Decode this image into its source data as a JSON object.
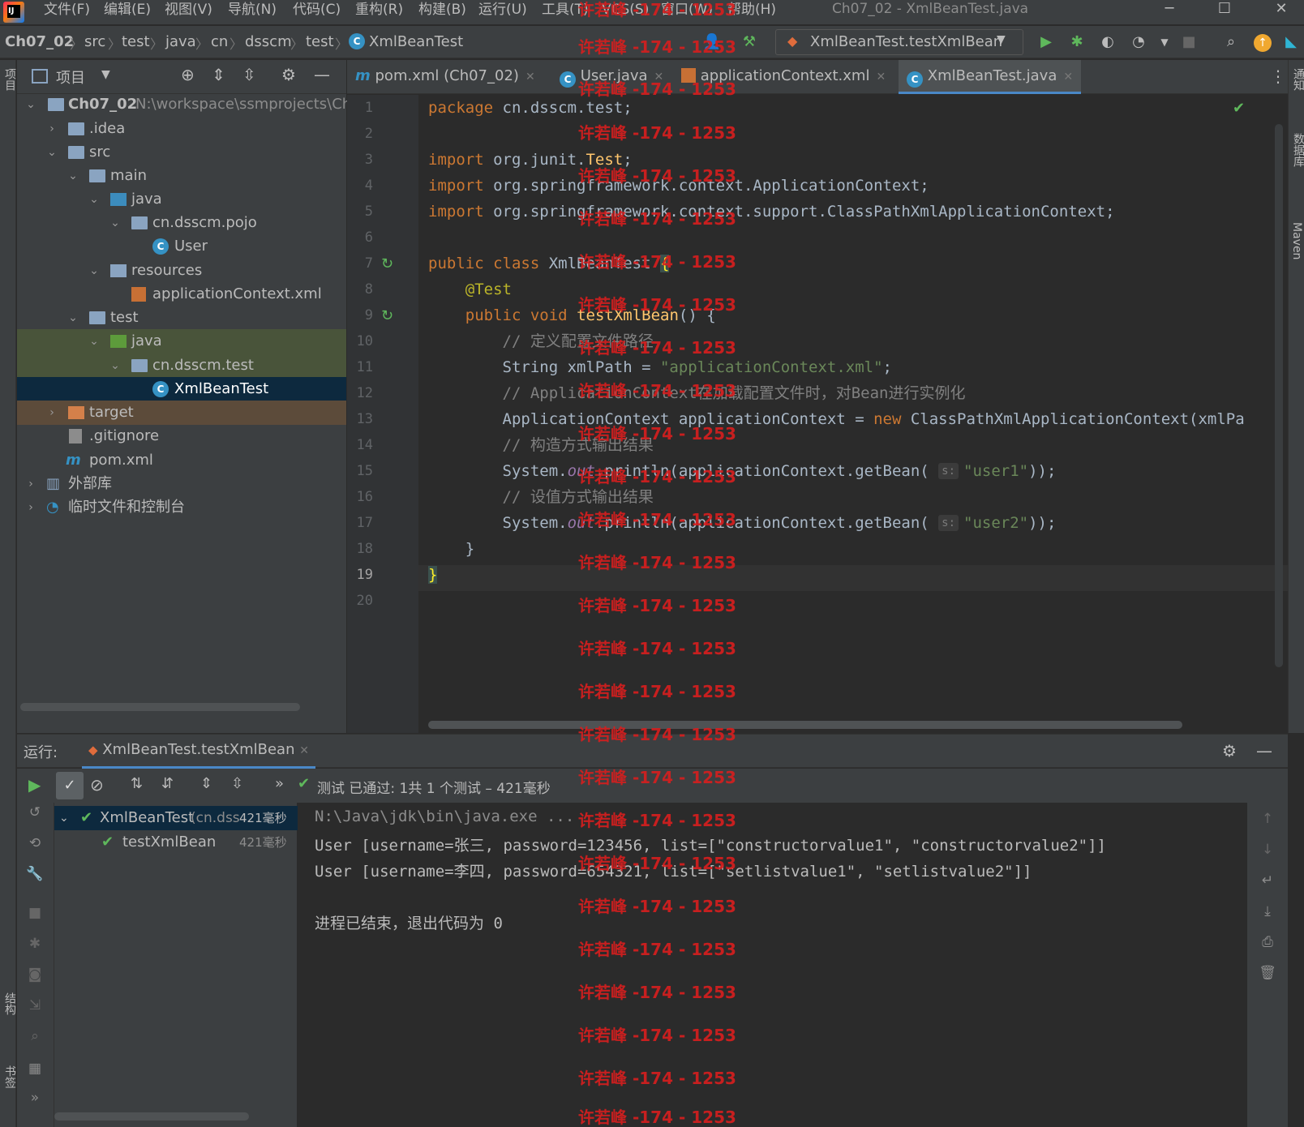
{
  "window": {
    "title": "Ch07_02 - XmlBeanTest.java"
  },
  "menu": [
    "文件(F)",
    "编辑(E)",
    "视图(V)",
    "导航(N)",
    "代码(C)",
    "重构(R)",
    "构建(B)",
    "运行(U)",
    "工具(T)",
    "VCS(S)",
    "窗口(W)",
    "帮助(H)"
  ],
  "breadcrumb": [
    "Ch07_02",
    "src",
    "test",
    "java",
    "cn",
    "dsscm",
    "test",
    "XmlBeanTest"
  ],
  "run_config": "XmlBeanTest.testXmlBean",
  "project": {
    "header": "项目",
    "tree": [
      {
        "label": "Ch07_02",
        "path": "N:\\workspace\\ssmprojects\\Ch"
      },
      {
        "label": ".idea"
      },
      {
        "label": "src"
      },
      {
        "label": "main"
      },
      {
        "label": "java"
      },
      {
        "label": "cn.dsscm.pojo"
      },
      {
        "label": "User"
      },
      {
        "label": "resources"
      },
      {
        "label": "applicationContext.xml"
      },
      {
        "label": "test"
      },
      {
        "label": "java"
      },
      {
        "label": "cn.dsscm.test"
      },
      {
        "label": "XmlBeanTest"
      },
      {
        "label": "target"
      },
      {
        "label": ".gitignore"
      },
      {
        "label": "pom.xml"
      },
      {
        "label": "外部库"
      },
      {
        "label": "临时文件和控制台"
      }
    ]
  },
  "tabs": [
    "pom.xml (Ch07_02)",
    "User.java",
    "applicationContext.xml",
    "XmlBeanTest.java"
  ],
  "code": {
    "pkg": "cn.dsscm.test",
    "imp1": "org.junit.",
    "imp1b": "Test",
    "imp2": "org.springframework.context.ApplicationContext",
    "imp3": "org.springframework.context.support.ClassPathXmlApplicationContext",
    "cls": "XmlBeanTest",
    "anno": "@Test",
    "method": "testXmlBean",
    "c1": "// 定义配置文件路径",
    "xmlpath": "\"applicationContext.xml\"",
    "c2": "// ApplicationContext在加载配置文件时，对Bean进行实例化",
    "line13b": "ClassPathXmlApplicationContext(xmlPa",
    "c3": "// 构造方式输出结果",
    "user1": "\"user1\"",
    "c4": "// 设值方式输出结果",
    "user2": "\"user2\"",
    "hint": "s:"
  },
  "line_numbers": [
    "1",
    "2",
    "3",
    "4",
    "5",
    "6",
    "7",
    "8",
    "9",
    "10",
    "11",
    "12",
    "13",
    "14",
    "15",
    "16",
    "17",
    "18",
    "19",
    "20"
  ],
  "run": {
    "label": "运行:",
    "tab": "XmlBeanTest.testXmlBean",
    "status": "测试 已通过: 1共 1 个测试 – 421毫秒",
    "tree_root": "XmlBeanTest",
    "tree_root_pkg": "(cn.dss",
    "tree_root_time": "421毫秒",
    "tree_child": "testXmlBean",
    "tree_child_time": "421毫秒"
  },
  "console": [
    "N:\\Java\\jdk\\bin\\java.exe ...",
    "User [username=张三, password=123456, list=[\"constructorvalue1\", \"constructorvalue2\"]]",
    "User [username=李四, password=654321, list=[\"setlistvalue1\", \"setlistvalue2\"]]",
    "",
    "进程已结束，退出代码为 0"
  ],
  "watermark": "许若峰 -174 - 1253",
  "side_labels": {
    "right1": "通知",
    "right2": "数据库",
    "right3": "Maven",
    "left1": "项目",
    "left2": "结构",
    "left3": "书签"
  },
  "colors": {
    "keyword": "#cc7832",
    "string": "#6a8759",
    "annotation": "#bbb529",
    "comment": "#808080",
    "selection": "#0d293e",
    "test_folder": "#49543a",
    "target_folder": "#5c4b3a",
    "accent": "#4a88c7",
    "pass": "#5fb85c",
    "watermark": "#d81e1e"
  }
}
